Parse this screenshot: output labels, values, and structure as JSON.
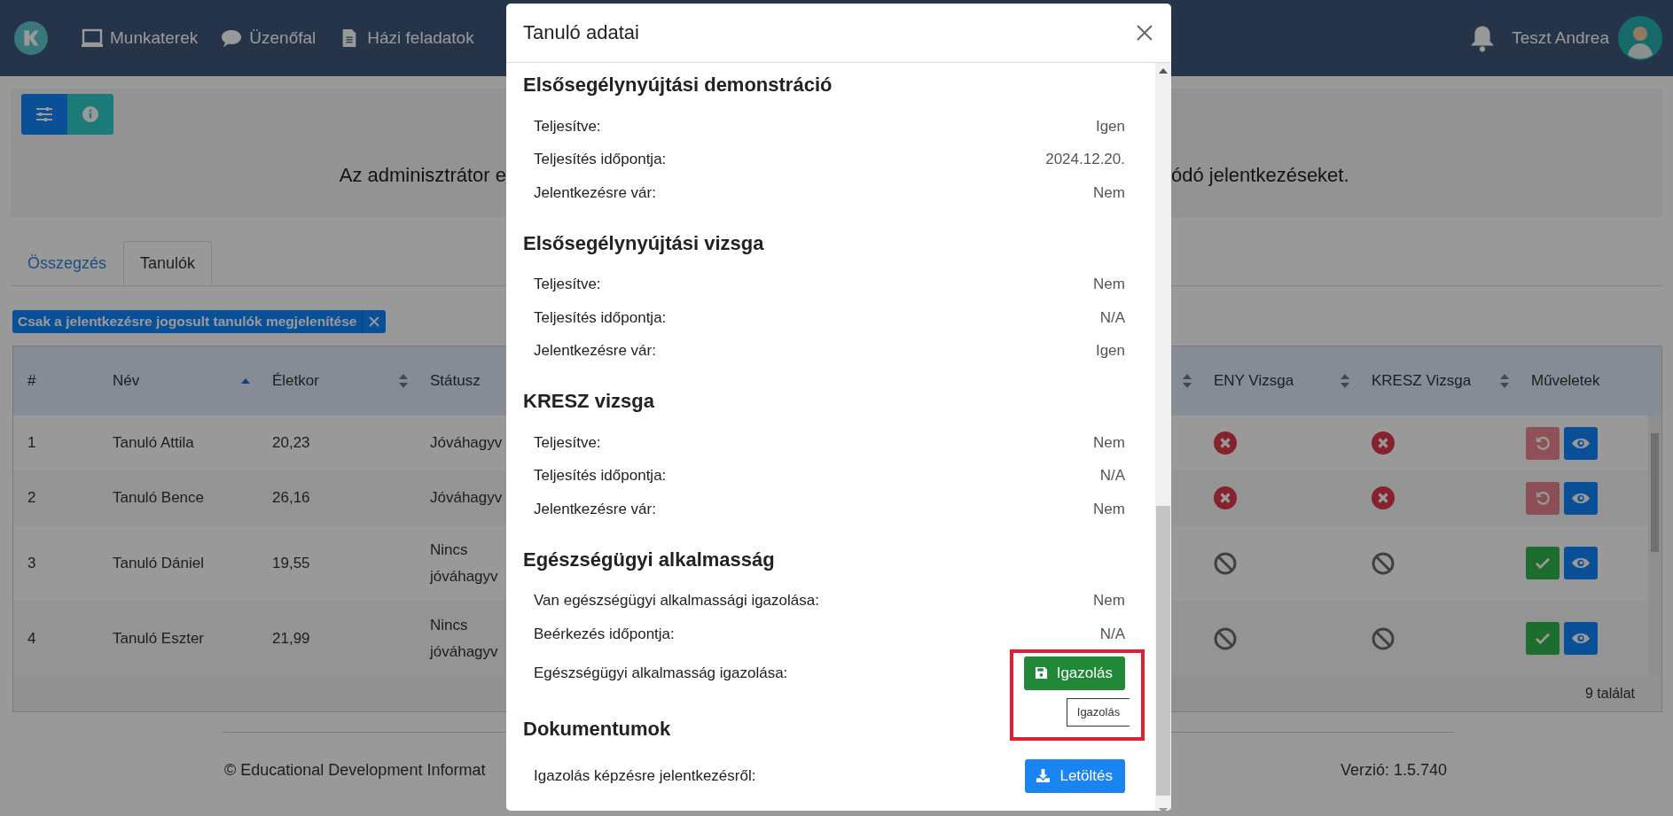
{
  "navbar": {
    "items": [
      {
        "label": "Munkaterek",
        "kind": "monitor"
      },
      {
        "label": "Üzenőfal",
        "kind": "chat"
      },
      {
        "label": "Házi feladatok",
        "kind": "document"
      }
    ],
    "user_name": "Teszt Andrea"
  },
  "notice": {
    "visible_start": "Az adminisztrátor e",
    "visible_end": "ódó jelentkezéseket."
  },
  "tabs": [
    {
      "label": "Összegzés",
      "selected": false
    },
    {
      "label": "Tanulók",
      "selected": true
    }
  ],
  "filter_chip": {
    "label": "Csak a jelentkezésre jogosult tanulók megjelenítése"
  },
  "table": {
    "columns": [
      {
        "label": "#",
        "sortable": false,
        "sorted": false
      },
      {
        "label": "Név",
        "sortable": true,
        "sorted": true
      },
      {
        "label": "Életkor",
        "sortable": true,
        "sorted": false
      },
      {
        "label": "Státusz",
        "sortable": false,
        "sorted": false
      },
      {
        "sortable": true,
        "sorted": false
      },
      {
        "label": "ENY Vizsga",
        "sortable": true,
        "sorted": false
      },
      {
        "label": "KRESZ Vizsga",
        "sortable": true,
        "sorted": false
      },
      {
        "label": "Műveletek",
        "sortable": false,
        "sorted": false
      }
    ],
    "rows": [
      {
        "number": "1",
        "name": "Tanuló Attila",
        "age": "20,23",
        "status": "Jóváhagyv",
        "eny_exam": {
          "kind": "failed"
        },
        "kresz_exam": {
          "kind": "failed"
        },
        "actions": [
          {
            "kind": "undo",
            "disabled": true
          },
          {
            "kind": "view",
            "disabled": false
          }
        ]
      },
      {
        "number": "2",
        "name": "Tanuló Bence",
        "age": "26,16",
        "status": "Jóváhagyv",
        "eny_exam": {
          "kind": "failed"
        },
        "kresz_exam": {
          "kind": "failed"
        },
        "actions": [
          {
            "kind": "undo",
            "disabled": true
          },
          {
            "kind": "view",
            "disabled": false
          }
        ]
      },
      {
        "number": "3",
        "name": "Tanuló Dániel",
        "age": "19,55",
        "status": "Nincs jóváhagyv",
        "eny_exam": {
          "kind": "blocked"
        },
        "kresz_exam": {
          "kind": "blocked"
        },
        "actions": [
          {
            "kind": "approve",
            "disabled": false
          },
          {
            "kind": "view",
            "disabled": false
          }
        ]
      },
      {
        "number": "4",
        "name": "Tanuló Eszter",
        "age": "21,99",
        "status": "Nincs jóváhagyv",
        "eny_exam": {
          "kind": "blocked"
        },
        "kresz_exam": {
          "kind": "blocked"
        },
        "actions": [
          {
            "kind": "approve",
            "disabled": false
          },
          {
            "kind": "view",
            "disabled": false
          }
        ]
      }
    ],
    "result_count": "9 találat"
  },
  "footer": {
    "copyright": "© Educational Development Informat",
    "version": "Verzió: 1.5.740"
  },
  "modal": {
    "title": "Tanuló adatai",
    "sections": [
      {
        "heading": "Elsősegélynyújtási demonstráció",
        "rows": [
          {
            "kind": "text",
            "label": "Teljesítve:",
            "value": "Igen"
          },
          {
            "kind": "text",
            "label": "Teljesítés időpontja:",
            "value": "2024.12.20."
          },
          {
            "kind": "text",
            "label": "Jelentkezésre vár:",
            "value": "Nem"
          }
        ]
      },
      {
        "heading": "Elsősegélynyújtási vizsga",
        "rows": [
          {
            "kind": "text",
            "label": "Teljesítve:",
            "value": "Nem"
          },
          {
            "kind": "text",
            "label": "Teljesítés időpontja:",
            "value": "N/A"
          },
          {
            "kind": "text",
            "label": "Jelentkezésre vár:",
            "value": "Igen"
          }
        ]
      },
      {
        "heading": "KRESZ vizsga",
        "rows": [
          {
            "kind": "text",
            "label": "Teljesítve:",
            "value": "Nem"
          },
          {
            "kind": "text",
            "label": "Teljesítés időpontja:",
            "value": "N/A"
          },
          {
            "kind": "text",
            "label": "Jelentkezésre vár:",
            "value": "Nem"
          }
        ]
      },
      {
        "heading": "Egészségügyi alkalmasság",
        "rows": [
          {
            "kind": "text",
            "label": "Van egészségügyi alkalmassági igazolása:",
            "value": "Nem"
          },
          {
            "kind": "text",
            "label": "Beérkezés időpontja:",
            "value": "N/A"
          },
          {
            "kind": "button",
            "label": "Egészségügyi alkalmasság igazolása:",
            "button": {
              "kind": "save",
              "label": "Igazolás"
            },
            "tooltip": "Igazolás",
            "highlighted": true
          }
        ]
      },
      {
        "heading": "Dokumentumok",
        "rows": [
          {
            "kind": "button",
            "label": "Igazolás képzésre jelentkezésről:",
            "button": {
              "kind": "download",
              "label": "Letöltés"
            },
            "highlighted": false
          }
        ]
      }
    ]
  }
}
